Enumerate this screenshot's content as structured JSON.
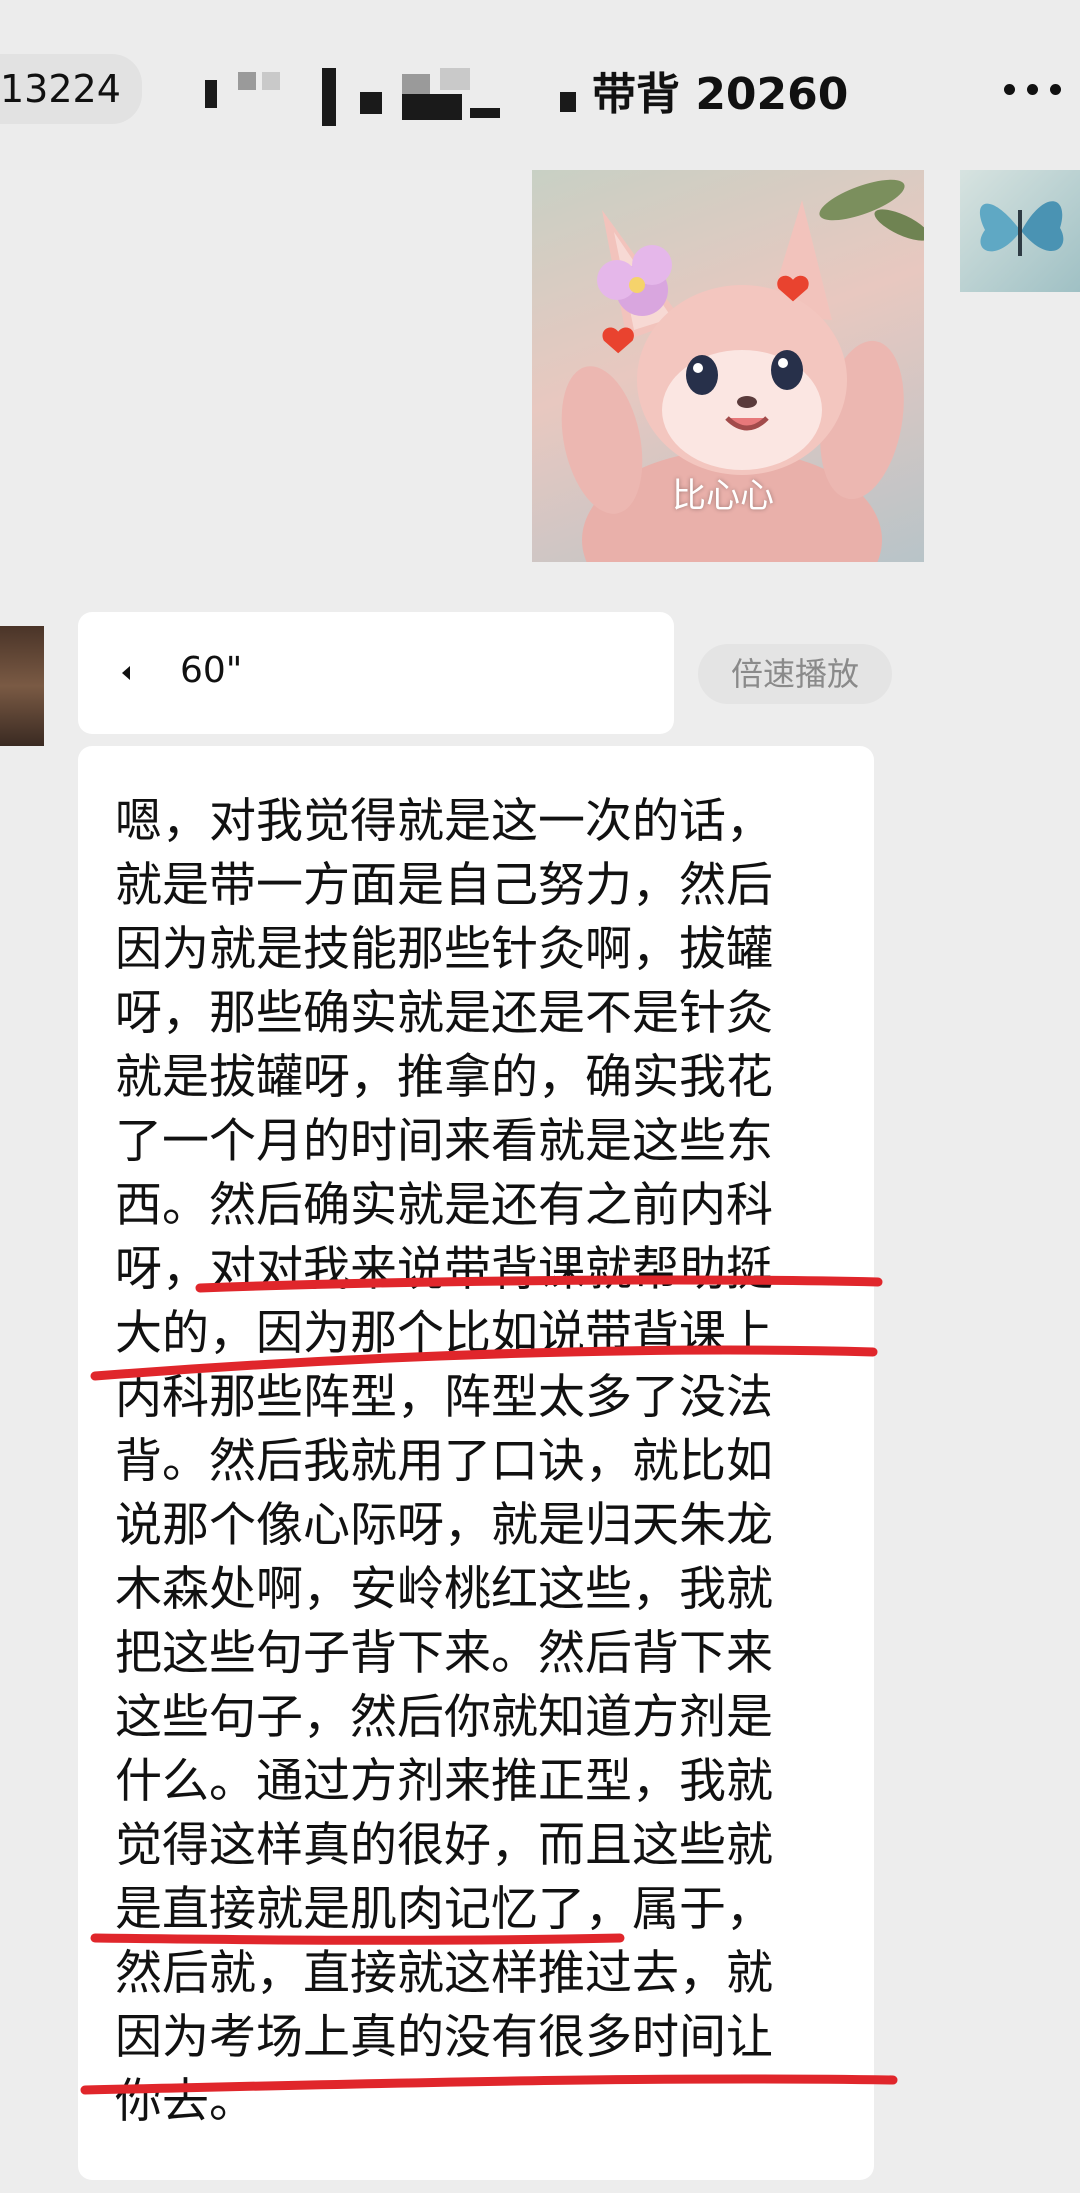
{
  "header": {
    "back_count": "13224",
    "title_visible": "带背 20260",
    "more_icon": "more-dots-icon"
  },
  "sticker": {
    "caption": "比心心"
  },
  "voice_message": {
    "duration": "60\"",
    "speed_label": "倍速播放"
  },
  "transcript": {
    "lines": [
      "嗯，对我觉得就是这一次的话，",
      "就是带一方面是自己努力，然后",
      "因为就是技能那些针灸啊，拔罐",
      "呀，那些确实就是还是不是针灸",
      "就是拔罐呀，推拿的，确实我花",
      "了一个月的时间来看就是这些东",
      "西。然后确实就是还有之前内科",
      "呀，对对我来说带背课就帮助挺",
      "大的，因为那个比如说带背课上",
      "内科那些阵型，阵型太多了没法",
      "背。然后我就用了口诀，就比如",
      "说那个像心际呀，就是归天朱龙",
      "木森处啊，安岭桃红这些，我就",
      "把这些句子背下来。然后背下来",
      "这些句子，然后你就知道方剂是",
      "什么。通过方剂来推正型，我就",
      "觉得这样真的很好，而且这些就",
      "是直接就是肌肉记忆了，属于，",
      "然后就，直接就这样推过去，就",
      "因为考场上真的没有很多时间让",
      "你去。"
    ]
  },
  "colors": {
    "background": "#ededed",
    "bubble": "#ffffff",
    "underline": "#e0262b"
  }
}
